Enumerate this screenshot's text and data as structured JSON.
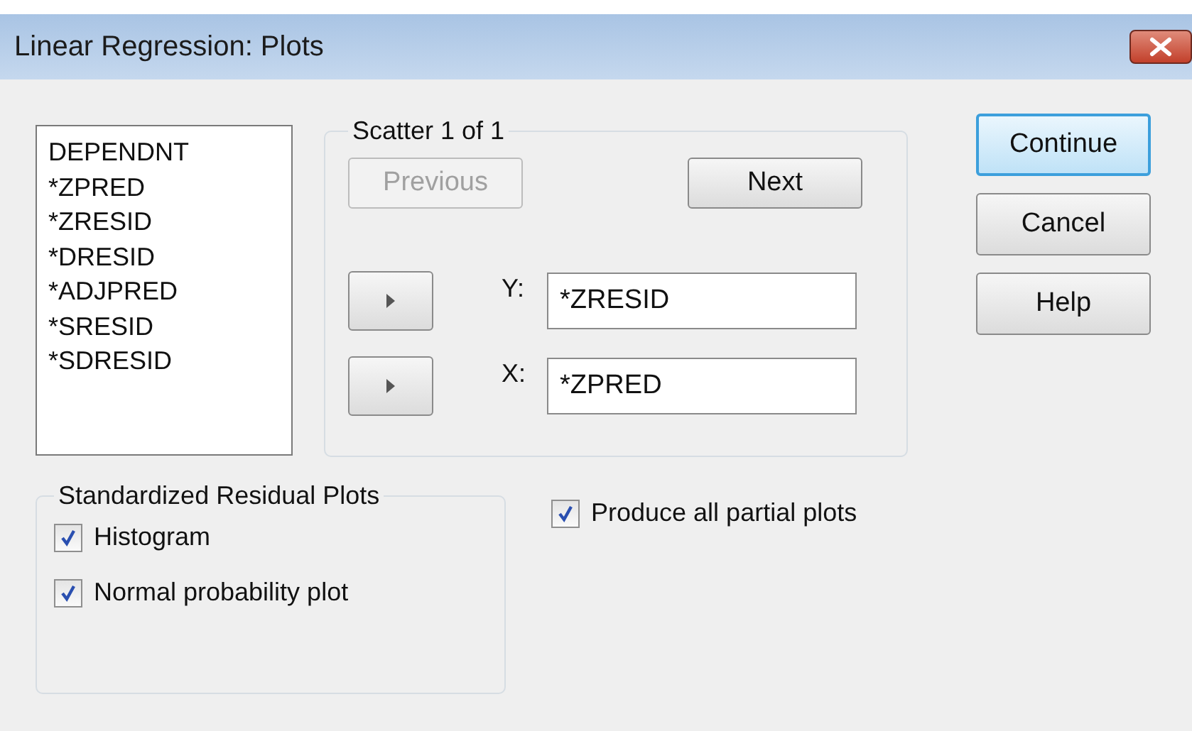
{
  "window": {
    "title": "Linear Regression: Plots"
  },
  "variables": [
    "DEPENDNT",
    "*ZPRED",
    "*ZRESID",
    "*DRESID",
    "*ADJPRED",
    "*SRESID",
    "*SDRESID"
  ],
  "scatter": {
    "title": "Scatter 1 of 1",
    "previous": {
      "label": "Previous",
      "disabled": true
    },
    "next": {
      "label": "Next",
      "disabled": false
    },
    "axes": [
      {
        "label": "Y:",
        "value": "*ZRESID"
      },
      {
        "label": "X:",
        "value": "*ZPRED"
      }
    ]
  },
  "buttons": [
    {
      "label": "Continue",
      "focused": true
    },
    {
      "label": "Cancel",
      "focused": false
    },
    {
      "label": "Help",
      "focused": false
    }
  ],
  "standardized_residual_plots": {
    "title": "Standardized Residual Plots",
    "options": [
      {
        "label": "Histogram",
        "checked": true
      },
      {
        "label": "Normal probability plot",
        "checked": true
      }
    ]
  },
  "partial_plots": {
    "label": "Produce all partial plots",
    "checked": true
  }
}
